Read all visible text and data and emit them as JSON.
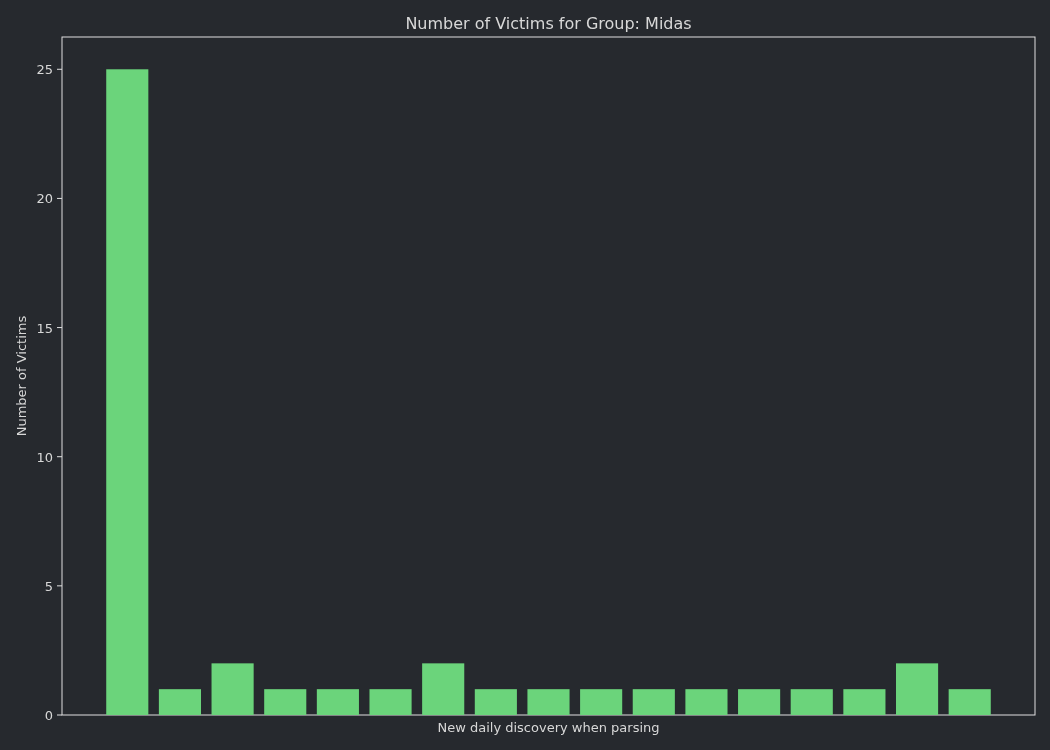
{
  "chart_data": {
    "type": "bar",
    "title": "Number of Victims for Group: Midas",
    "xlabel": "New daily discovery when parsing",
    "ylabel": "Number of Victims",
    "series": [
      {
        "color": "#6bd47b",
        "values": [
          25,
          1,
          2,
          1,
          1,
          1,
          2,
          1,
          1,
          1,
          1,
          1,
          1,
          1,
          1,
          2,
          1
        ]
      }
    ],
    "ylim": [
      0,
      26.25
    ],
    "yticks": [
      0,
      5,
      10,
      15,
      20,
      25
    ]
  }
}
